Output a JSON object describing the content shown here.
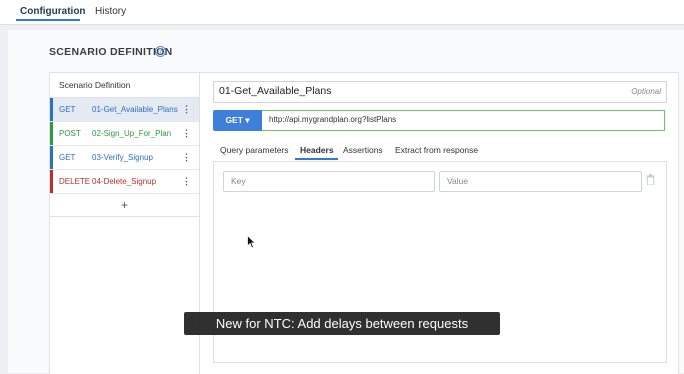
{
  "tabs": [
    {
      "label": "Configuration",
      "active": true
    },
    {
      "label": "History",
      "active": false
    }
  ],
  "section_title": "SCENARIO DEFINITION",
  "help_icon": "question-circle-icon",
  "scenario_list": {
    "header": "Scenario Definition",
    "items": [
      {
        "method": "GET",
        "name": "01-Get_Available_Plans",
        "color": "#2f6fbf",
        "selected": true
      },
      {
        "method": "POST",
        "name": "02-Sign_Up_For_Plan",
        "color": "#2e9a3e",
        "selected": false
      },
      {
        "method": "GET",
        "name": "03-Verify_Signup",
        "color": "#2f6fbf",
        "selected": false
      },
      {
        "method": "DELETE",
        "name": "04-Delete_Signup",
        "color": "#b8312f",
        "selected": false
      }
    ],
    "add_label": "+"
  },
  "request": {
    "name": "01-Get_Available_Plans",
    "name_hint": "Optional",
    "method_label": "GET ▾",
    "url": "http://api.mygrandplan.org?listPlans"
  },
  "subtabs": [
    {
      "label": "Query parameters",
      "active": false
    },
    {
      "label": "Headers",
      "active": true
    },
    {
      "label": "Assertions",
      "active": false
    },
    {
      "label": "Extract from response",
      "active": false
    }
  ],
  "headers_editor": {
    "key_placeholder": "Key",
    "value_placeholder": "Value",
    "delete_icon": "trash-icon"
  },
  "caption": "New for NTC: Add delays between requests",
  "colors": {
    "accent": "#2e7bd6",
    "method_button": "#3d7fd9",
    "url_border": "#6cc070"
  }
}
